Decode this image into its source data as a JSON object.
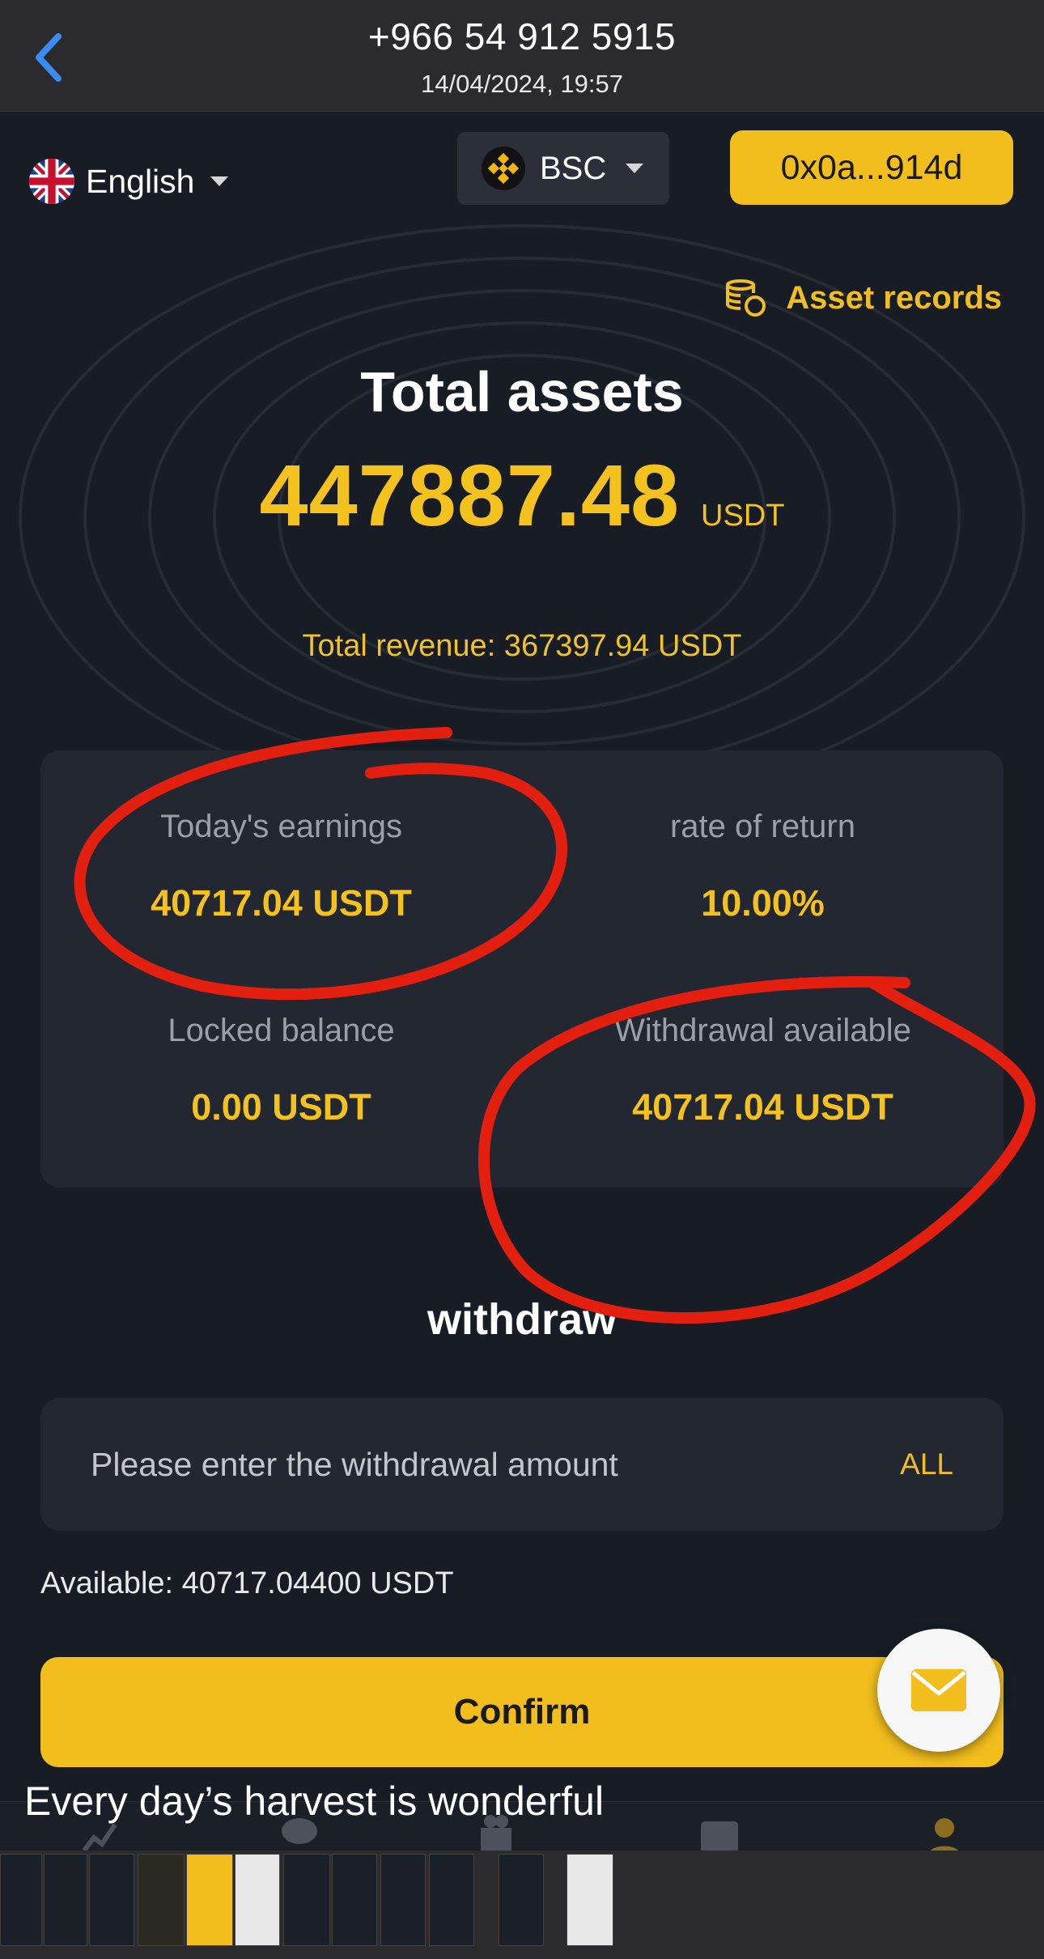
{
  "viewer": {
    "title": "+966 54 912 5915",
    "subtitle": "14/04/2024, 19:57",
    "back_icon": "chevron-left-icon"
  },
  "header": {
    "language": "English",
    "network": "BSC",
    "wallet": "0x0a...914d"
  },
  "asset_records_label": "Asset records",
  "total": {
    "title": "Total assets",
    "value": "447887.48",
    "unit": "USDT",
    "revenue": "Total revenue: 367397.94 USDT"
  },
  "stats": [
    {
      "label": "Today's earnings",
      "value": "40717.04 USDT"
    },
    {
      "label": "rate of return",
      "value": "10.00%"
    },
    {
      "label": "Locked balance",
      "value": "0.00 USDT"
    },
    {
      "label": "Withdrawal available",
      "value": "40717.04 USDT"
    }
  ],
  "withdraw": {
    "title": "withdraw",
    "placeholder": "Please enter the withdrawal amount",
    "all_label": "ALL",
    "available": "Available: 40717.04400 USDT",
    "confirm_label": "Confirm"
  },
  "caption": "Every day’s harvest is wonderful",
  "colors": {
    "accent": "#f2be1d",
    "background": "#181c25",
    "card": "#222732",
    "annotation": "#e3200f"
  },
  "icons": [
    "uk-flag-icon",
    "bnb-icon",
    "coins-icon",
    "mail-icon",
    "chart-icon",
    "chat-icon",
    "gift-icon",
    "id-card-icon",
    "user-icon"
  ]
}
